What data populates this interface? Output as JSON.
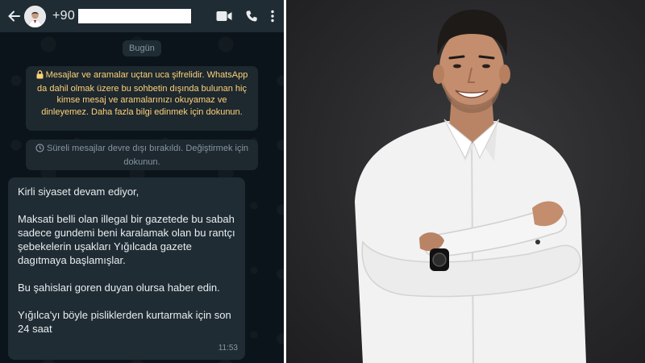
{
  "header": {
    "phone_prefix": "+90",
    "icons": [
      "back-arrow-icon",
      "video-call-icon",
      "phone-icon",
      "more-options-icon"
    ]
  },
  "date_label": "Bugün",
  "encryption_notice": "Mesajlar ve aramalar uçtan uca şifrelidir. WhatsApp da dahil olmak üzere bu sohbetin dışında bulunan hiç kimse mesaj ve aramalarınızı okuyamaz ve dinleyemez. Daha fazla bilgi edinmek için dokunun.",
  "disappearing_notice": "Süreli mesajlar devre dışı bırakıldı. Değiştirmek için dokunun.",
  "message": {
    "p1": "Kirli siyaset devam ediyor,",
    "p2": "Maksati belli olan illegal bir gazetede bu sabah sadece gundemi beni karalamak olan bu rantçı şebekelerin uşakları Yığılcada gazete dagıtmaya başlamışlar.",
    "p3": "Bu şahislari goren duyan olursa haber edin.",
    "p4": "Yığılca'yı böyle pisliklerden kurtarmak için son 24 saat",
    "time": "11:53"
  },
  "colors": {
    "chat_background": "#0b141a",
    "header_background": "#1f2c34",
    "bubble_background": "#1f2c34",
    "system_text": "#ffd279",
    "photo_background": "#2a2a2c"
  }
}
